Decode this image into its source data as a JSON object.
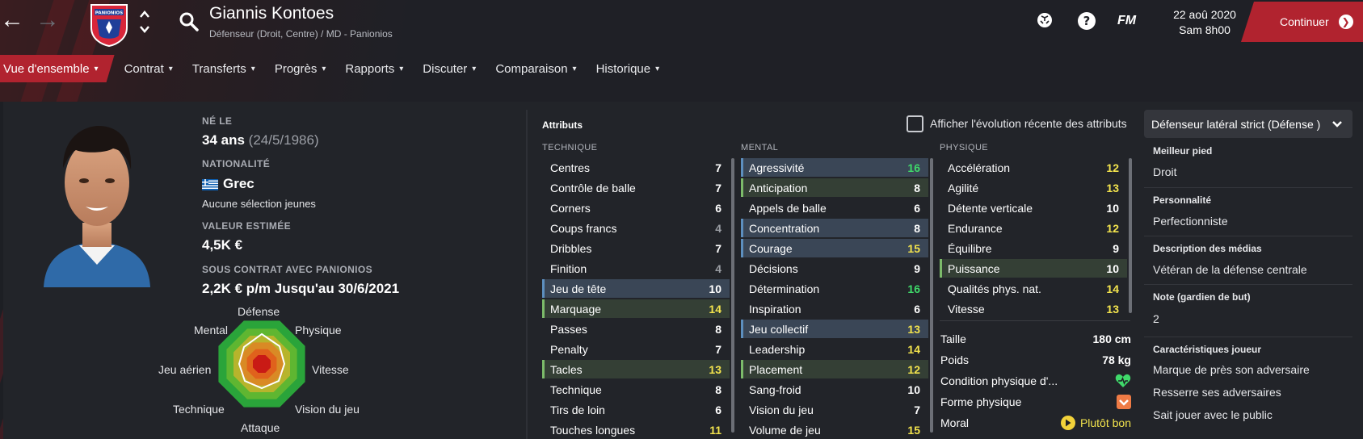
{
  "header": {
    "player_name": "Giannis Kontoes",
    "player_subtitle": "Défenseur (Droit, Centre) / MD - Panionios",
    "club_crest_text": "PANIONIOS",
    "date": "22 aoû 2020",
    "time": "Sam 8h00",
    "continue_label": "Continuer",
    "fm_label": "FM"
  },
  "tabs": [
    {
      "label": "Vue d'ensemble",
      "active": true
    },
    {
      "label": "Contrat"
    },
    {
      "label": "Transferts"
    },
    {
      "label": "Progrès"
    },
    {
      "label": "Rapports"
    },
    {
      "label": "Discuter"
    },
    {
      "label": "Comparaison"
    },
    {
      "label": "Historique"
    }
  ],
  "profile": {
    "born_label": "NÉ LE",
    "age": "34 ans",
    "birth_date": "(24/5/1986)",
    "nationality_label": "NATIONALITÉ",
    "nationality": "Grec",
    "youth_caps": "Aucune sélection jeunes",
    "value_label": "VALEUR ESTIMÉE",
    "value": "4,5K €",
    "contract_label": "SOUS CONTRAT AVEC PANIONIOS",
    "contract": "2,2K € p/m Jusqu'au 30/6/2021"
  },
  "radar": {
    "labels": [
      "Défense",
      "Physique",
      "Vitesse",
      "Vision du jeu",
      "Attaque",
      "Technique",
      "Jeu aérien",
      "Mental"
    ]
  },
  "attributes": {
    "title": "Attributs",
    "show_recent_label": "Afficher l'évolution récente des attributs",
    "role": "Défenseur latéral strict (Défense )",
    "technique_label": "TECHNIQUE",
    "mental_label": "MENTAL",
    "physique_label": "PHYSIQUE",
    "technique": [
      {
        "name": "Centres",
        "value": "7",
        "hl": ""
      },
      {
        "name": "Contrôle de balle",
        "value": "7",
        "hl": ""
      },
      {
        "name": "Corners",
        "value": "6",
        "hl": ""
      },
      {
        "name": "Coups francs",
        "value": "4",
        "hl": ""
      },
      {
        "name": "Dribbles",
        "value": "7",
        "hl": ""
      },
      {
        "name": "Finition",
        "value": "4",
        "hl": ""
      },
      {
        "name": "Jeu de tête",
        "value": "10",
        "hl": "blue"
      },
      {
        "name": "Marquage",
        "value": "14",
        "hl": "green"
      },
      {
        "name": "Passes",
        "value": "8",
        "hl": ""
      },
      {
        "name": "Penalty",
        "value": "7",
        "hl": ""
      },
      {
        "name": "Tacles",
        "value": "13",
        "hl": "green"
      },
      {
        "name": "Technique",
        "value": "8",
        "hl": ""
      },
      {
        "name": "Tirs de loin",
        "value": "6",
        "hl": ""
      },
      {
        "name": "Touches longues",
        "value": "11",
        "hl": ""
      }
    ],
    "mental": [
      {
        "name": "Agressivité",
        "value": "16",
        "hl": "blue"
      },
      {
        "name": "Anticipation",
        "value": "8",
        "hl": "green"
      },
      {
        "name": "Appels de balle",
        "value": "6",
        "hl": ""
      },
      {
        "name": "Concentration",
        "value": "8",
        "hl": "blue"
      },
      {
        "name": "Courage",
        "value": "15",
        "hl": "blue"
      },
      {
        "name": "Décisions",
        "value": "9",
        "hl": ""
      },
      {
        "name": "Détermination",
        "value": "16",
        "hl": ""
      },
      {
        "name": "Inspiration",
        "value": "6",
        "hl": ""
      },
      {
        "name": "Jeu collectif",
        "value": "13",
        "hl": "blue"
      },
      {
        "name": "Leadership",
        "value": "14",
        "hl": ""
      },
      {
        "name": "Placement",
        "value": "12",
        "hl": "green"
      },
      {
        "name": "Sang-froid",
        "value": "10",
        "hl": ""
      },
      {
        "name": "Vision du jeu",
        "value": "7",
        "hl": ""
      },
      {
        "name": "Volume de jeu",
        "value": "15",
        "hl": ""
      }
    ],
    "physique": [
      {
        "name": "Accélération",
        "value": "12",
        "hl": ""
      },
      {
        "name": "Agilité",
        "value": "13",
        "hl": ""
      },
      {
        "name": "Détente verticale",
        "value": "10",
        "hl": ""
      },
      {
        "name": "Endurance",
        "value": "12",
        "hl": ""
      },
      {
        "name": "Équilibre",
        "value": "9",
        "hl": ""
      },
      {
        "name": "Puissance",
        "value": "10",
        "hl": "green"
      },
      {
        "name": "Qualités phys. nat.",
        "value": "14",
        "hl": ""
      },
      {
        "name": "Vitesse",
        "value": "13",
        "hl": ""
      }
    ],
    "height_label": "Taille",
    "height": "180 cm",
    "weight_label": "Poids",
    "weight": "78 kg",
    "condition_label": "Condition physique d'...",
    "fitness_label": "Forme physique",
    "morale_label": "Moral",
    "morale": "Plutôt bon"
  },
  "details": {
    "best_foot_label": "Meilleur pied",
    "best_foot": "Droit",
    "personality_label": "Personnalité",
    "personality": "Perfectionniste",
    "media_label": "Description des médias",
    "media": "Vétéran de la défense centrale",
    "gk_rating_label": "Note (gardien de but)",
    "gk_rating": "2",
    "traits_label": "Caractéristiques joueur",
    "traits": [
      "Marque de près son adversaire",
      "Resserre ses adversaires",
      "Sait jouer avec le public"
    ]
  },
  "colors": {
    "accent": "#b1232f",
    "attr_white": "#ffffff",
    "attr_grey": "#9a9da3",
    "attr_yellow": "#f2e34d",
    "attr_green": "#3fd96a"
  }
}
